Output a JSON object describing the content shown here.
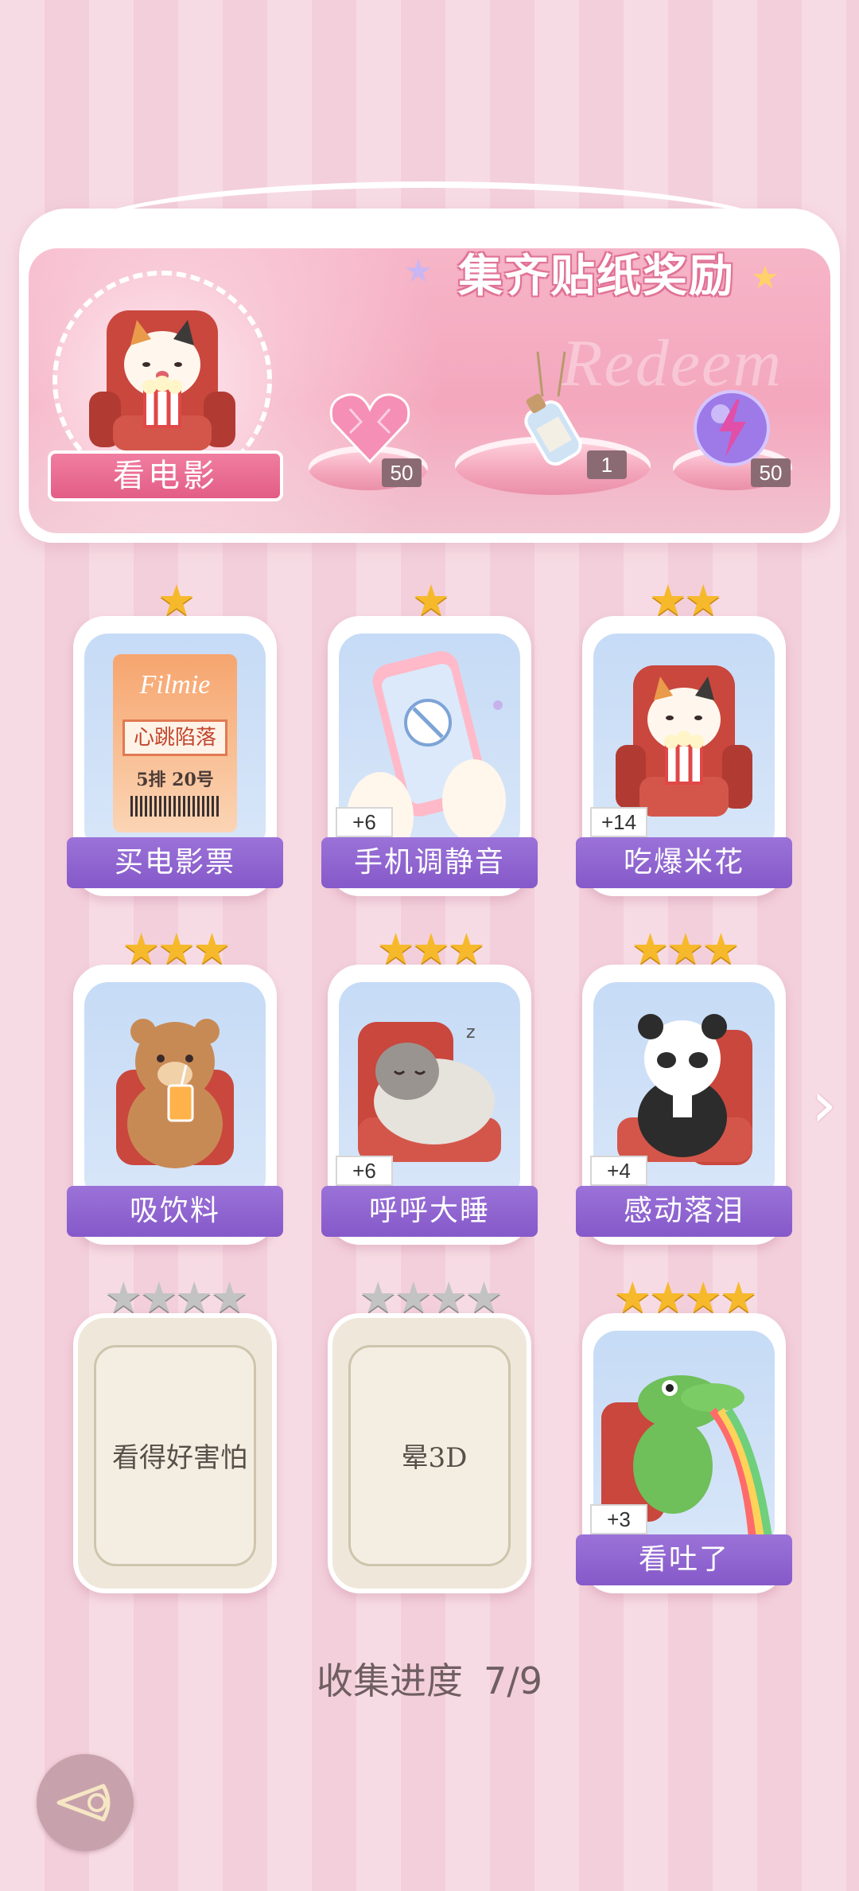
{
  "banner": {
    "title": "集齐贴纸奖励",
    "watermark": "Redeem",
    "theme_label": "看电影",
    "rewards": [
      {
        "icon": "pink-heart-gem-icon",
        "count": "50"
      },
      {
        "icon": "message-in-bottle-icon",
        "count": "1"
      },
      {
        "icon": "purple-lightning-orb-icon",
        "count": "50"
      }
    ]
  },
  "stickers": [
    {
      "name": "买电影票",
      "stars": 1,
      "max_stars": 1,
      "bonus": "",
      "collected": true,
      "ticket": {
        "brand": "Filmie",
        "movie": "心跳陷落",
        "seat": "5排 20号"
      }
    },
    {
      "name": "手机调静音",
      "stars": 1,
      "max_stars": 1,
      "bonus": "+6",
      "collected": true
    },
    {
      "name": "吃爆米花",
      "stars": 2,
      "max_stars": 2,
      "bonus": "+14",
      "collected": true
    },
    {
      "name": "吸饮料",
      "stars": 3,
      "max_stars": 3,
      "bonus": "",
      "collected": true
    },
    {
      "name": "呼呼大睡",
      "stars": 3,
      "max_stars": 3,
      "bonus": "+6",
      "collected": true
    },
    {
      "name": "感动落泪",
      "stars": 3,
      "max_stars": 3,
      "bonus": "+4",
      "collected": true
    },
    {
      "name": "看得好害怕",
      "stars": 0,
      "max_stars": 4,
      "bonus": "",
      "collected": false
    },
    {
      "name": "晕3D",
      "stars": 0,
      "max_stars": 4,
      "bonus": "",
      "collected": false
    },
    {
      "name": "看吐了",
      "stars": 4,
      "max_stars": 4,
      "bonus": "+3",
      "collected": true
    }
  ],
  "progress": {
    "label": "收集进度",
    "value": "7/9",
    "collected": 7,
    "total": 9
  },
  "colors": {
    "name_banner": "#8559c9",
    "gold_star": "#f7b92c",
    "gray_star": "#c3c3c3",
    "theme_pink": "#e35d86"
  }
}
